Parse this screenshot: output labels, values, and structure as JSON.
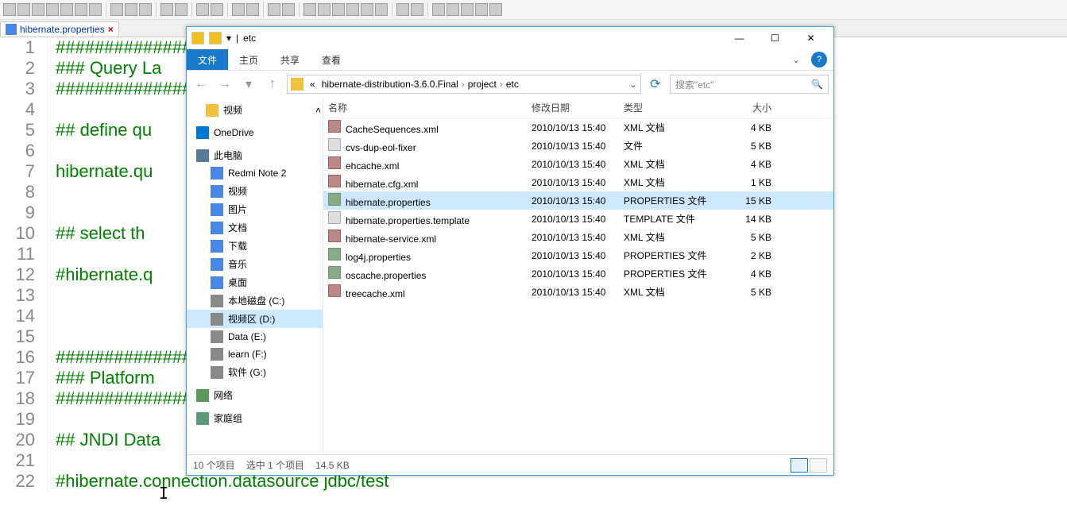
{
  "editor": {
    "tab_label": "hibernate.properties",
    "lines": [
      "#################",
      "### Query La",
      "#################",
      "",
      "## define qu",
      "",
      "hibernate.qu",
      "",
      "",
      "## select th",
      "",
      "#hibernate.q                                                                 ranslatorFactory",
      "",
      "",
      "",
      "#################",
      "### Platform",
      "#################",
      "",
      "## JNDI Data",
      "",
      "#hibernate.connection.datasource jdbc/test"
    ]
  },
  "explorer": {
    "title": "etc",
    "ribbon": {
      "file": "文件",
      "home": "主页",
      "share": "共享",
      "view": "查看"
    },
    "breadcrumb": [
      "«",
      "hibernate-distribution-3.6.0.Final",
      "project",
      "etc"
    ],
    "search_placeholder": "搜索\"etc\"",
    "nav": {
      "video_top": "视频",
      "onedrive": "OneDrive",
      "this_pc": "此电脑",
      "redmi": "Redmi Note 2",
      "videos": "视频",
      "pictures": "图片",
      "documents": "文档",
      "downloads": "下载",
      "music": "音乐",
      "desktop": "桌面",
      "drive_c": "本地磁盘 (C:)",
      "drive_d": "视频区 (D:)",
      "drive_e": "Data (E:)",
      "drive_f": "learn (F:)",
      "drive_g": "软件 (G:)",
      "network": "网络",
      "homegroup": "家庭组"
    },
    "columns": {
      "name": "名称",
      "date": "修改日期",
      "type": "类型",
      "size": "大小"
    },
    "files": [
      {
        "name": "CacheSequences.xml",
        "date": "2010/10/13 15:40",
        "type": "XML 文档",
        "size": "4 KB",
        "kind": "xml"
      },
      {
        "name": "cvs-dup-eol-fixer",
        "date": "2010/10/13 15:40",
        "type": "文件",
        "size": "5 KB",
        "kind": "txt"
      },
      {
        "name": "ehcache.xml",
        "date": "2010/10/13 15:40",
        "type": "XML 文档",
        "size": "4 KB",
        "kind": "xml"
      },
      {
        "name": "hibernate.cfg.xml",
        "date": "2010/10/13 15:40",
        "type": "XML 文档",
        "size": "1 KB",
        "kind": "xml"
      },
      {
        "name": "hibernate.properties",
        "date": "2010/10/13 15:40",
        "type": "PROPERTIES 文件",
        "size": "15 KB",
        "kind": "prop",
        "selected": true
      },
      {
        "name": "hibernate.properties.template",
        "date": "2010/10/13 15:40",
        "type": "TEMPLATE 文件",
        "size": "14 KB",
        "kind": "txt"
      },
      {
        "name": "hibernate-service.xml",
        "date": "2010/10/13 15:40",
        "type": "XML 文档",
        "size": "5 KB",
        "kind": "xml"
      },
      {
        "name": "log4j.properties",
        "date": "2010/10/13 15:40",
        "type": "PROPERTIES 文件",
        "size": "2 KB",
        "kind": "prop"
      },
      {
        "name": "oscache.properties",
        "date": "2010/10/13 15:40",
        "type": "PROPERTIES 文件",
        "size": "4 KB",
        "kind": "prop"
      },
      {
        "name": "treecache.xml",
        "date": "2010/10/13 15:40",
        "type": "XML 文档",
        "size": "5 KB",
        "kind": "xml"
      }
    ],
    "status": {
      "count": "10 个项目",
      "selected": "选中 1 个项目",
      "size": "14.5 KB"
    }
  }
}
